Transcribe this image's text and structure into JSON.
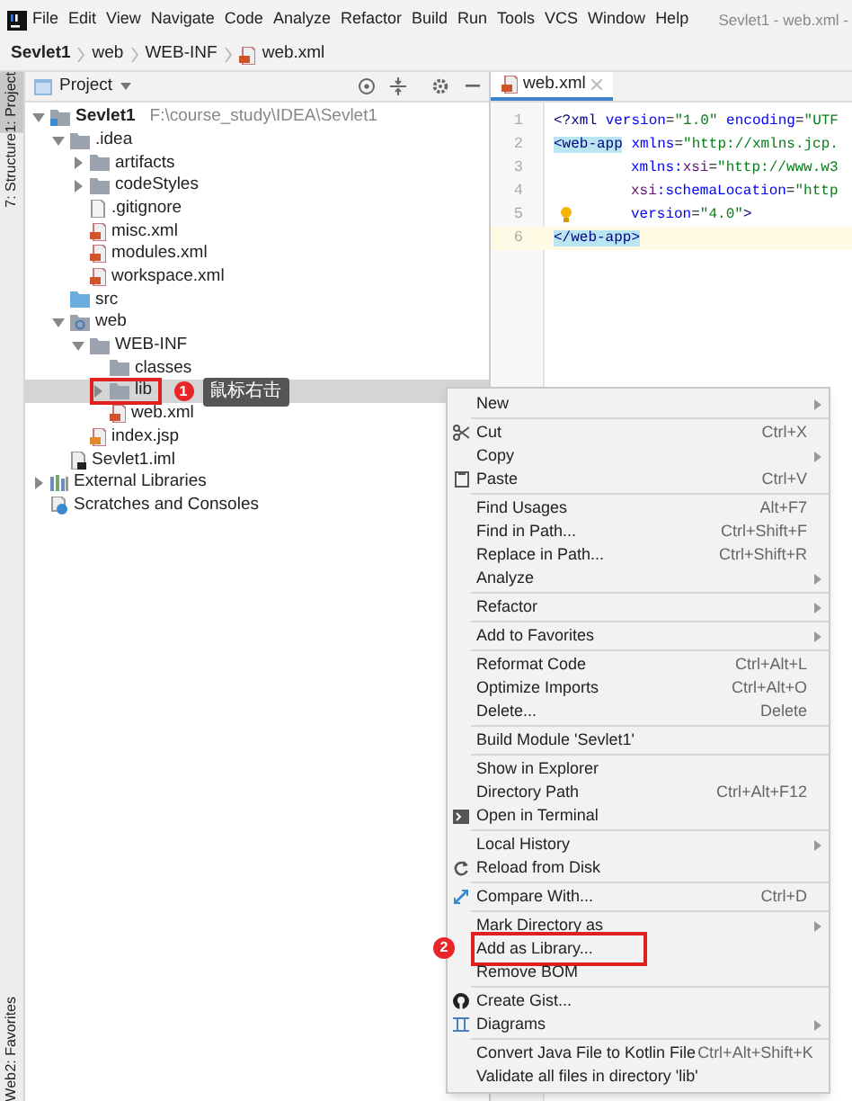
{
  "window": {
    "title": "Sevlet1 - web.xml -"
  },
  "menu_bar": [
    "File",
    "Edit",
    "View",
    "Navigate",
    "Code",
    "Analyze",
    "Refactor",
    "Build",
    "Run",
    "Tools",
    "VCS",
    "Window",
    "Help"
  ],
  "breadcrumb": [
    "Sevlet1",
    "web",
    "WEB-INF",
    "web.xml"
  ],
  "side_stripe": {
    "top": [
      {
        "label": "1: Project",
        "selected": true
      },
      {
        "label": "7: Structure",
        "selected": false
      }
    ],
    "bottom": [
      {
        "label": "2: Favorites",
        "selected": false
      },
      {
        "label": "Web",
        "selected": false
      }
    ]
  },
  "project_panel": {
    "title": "Project",
    "tree": [
      {
        "label": "Sevlet1",
        "path": "F:\\course_study\\IDEA\\Sevlet1",
        "kind": "project",
        "expanded": true,
        "selected": false,
        "children": [
          {
            "label": ".idea",
            "kind": "folder",
            "expanded": true,
            "selected": false,
            "children": [
              {
                "label": "artifacts",
                "kind": "folder",
                "expanded": false,
                "selected": false
              },
              {
                "label": "codeStyles",
                "kind": "folder",
                "expanded": false,
                "selected": false
              },
              {
                "label": ".gitignore",
                "kind": "file",
                "selected": false
              },
              {
                "label": "misc.xml",
                "kind": "xml",
                "selected": false
              },
              {
                "label": "modules.xml",
                "kind": "xml",
                "selected": false
              },
              {
                "label": "workspace.xml",
                "kind": "xml",
                "selected": false
              }
            ]
          },
          {
            "label": "src",
            "kind": "source",
            "selected": false
          },
          {
            "label": "web",
            "kind": "web",
            "expanded": true,
            "selected": false,
            "children": [
              {
                "label": "WEB-INF",
                "kind": "folder",
                "expanded": true,
                "selected": false,
                "children": [
                  {
                    "label": "classes",
                    "kind": "folder",
                    "selected": false
                  },
                  {
                    "label": "lib",
                    "kind": "folder",
                    "expanded": false,
                    "selected": true,
                    "highlighted": true,
                    "badge": "1",
                    "note": "鼠标右击"
                  },
                  {
                    "label": "web.xml",
                    "kind": "xml",
                    "selected": false
                  }
                ]
              },
              {
                "label": "index.jsp",
                "kind": "jsp",
                "selected": false
              }
            ]
          },
          {
            "label": "Sevlet1.iml",
            "kind": "module",
            "selected": false
          }
        ]
      },
      {
        "label": "External Libraries",
        "kind": "libraries",
        "expanded": false,
        "selected": false
      },
      {
        "label": "Scratches and Consoles",
        "kind": "scratches",
        "selected": false
      }
    ]
  },
  "editor": {
    "tab": {
      "label": "web.xml",
      "selected": true
    },
    "lines": [
      {
        "number": "1",
        "current": false,
        "tokens": [
          {
            "text": "<?xml ",
            "kind": "tag"
          },
          {
            "text": "version",
            "kind": "attr"
          },
          {
            "text": "=",
            "kind": "plain"
          },
          {
            "text": "\"1.0\" ",
            "kind": "value"
          },
          {
            "text": "encoding",
            "kind": "attr"
          },
          {
            "text": "=",
            "kind": "plain"
          },
          {
            "text": "\"UTF",
            "kind": "value"
          }
        ]
      },
      {
        "number": "2",
        "current": false,
        "tokens": [
          {
            "text": "<web-app",
            "kind": "match"
          },
          {
            "text": " xmlns",
            "kind": "attr"
          },
          {
            "text": "=",
            "kind": "plain"
          },
          {
            "text": "\"http://xmlns.jcp.",
            "kind": "value"
          }
        ]
      },
      {
        "number": "3",
        "current": false,
        "indent": true,
        "tokens": [
          {
            "text": "xmlns:",
            "kind": "attr"
          },
          {
            "text": "xsi",
            "kind": "ns"
          },
          {
            "text": "=",
            "kind": "plain"
          },
          {
            "text": "\"http://www.w3",
            "kind": "value"
          }
        ]
      },
      {
        "number": "4",
        "current": false,
        "indent": true,
        "tokens": [
          {
            "text": "xsi",
            "kind": "ns"
          },
          {
            "text": ":schemaLocation",
            "kind": "attr"
          },
          {
            "text": "=",
            "kind": "plain"
          },
          {
            "text": "\"http",
            "kind": "value"
          }
        ]
      },
      {
        "number": "5",
        "current": false,
        "indent": true,
        "bulb": true,
        "tokens": [
          {
            "text": "version",
            "kind": "attr"
          },
          {
            "text": "=",
            "kind": "plain"
          },
          {
            "text": "\"4.0\"",
            "kind": "value"
          },
          {
            "text": ">",
            "kind": "tag"
          }
        ]
      },
      {
        "number": "6",
        "current": true,
        "tokens": [
          {
            "text": "</web-app>",
            "kind": "match"
          }
        ]
      }
    ]
  },
  "context_menu": [
    {
      "kind": "item",
      "label": "New",
      "submenu": true
    },
    {
      "kind": "separator"
    },
    {
      "kind": "item",
      "label": "Cut",
      "shortcut": "Ctrl+X",
      "submenu": false
    },
    {
      "kind": "item",
      "label": "Copy",
      "submenu": true
    },
    {
      "kind": "item",
      "label": "Paste",
      "shortcut": "Ctrl+V",
      "submenu": false
    },
    {
      "kind": "separator"
    },
    {
      "kind": "item",
      "label": "Find Usages",
      "shortcut": "Alt+F7",
      "submenu": false
    },
    {
      "kind": "item",
      "label": "Find in Path...",
      "shortcut": "Ctrl+Shift+F",
      "submenu": false
    },
    {
      "kind": "item",
      "label": "Replace in Path...",
      "shortcut": "Ctrl+Shift+R",
      "submenu": false
    },
    {
      "kind": "item",
      "label": "Analyze",
      "submenu": true
    },
    {
      "kind": "separator"
    },
    {
      "kind": "item",
      "label": "Refactor",
      "submenu": true
    },
    {
      "kind": "separator"
    },
    {
      "kind": "item",
      "label": "Add to Favorites",
      "submenu": true
    },
    {
      "kind": "separator"
    },
    {
      "kind": "item",
      "label": "Reformat Code",
      "shortcut": "Ctrl+Alt+L",
      "submenu": false
    },
    {
      "kind": "item",
      "label": "Optimize Imports",
      "shortcut": "Ctrl+Alt+O",
      "submenu": false
    },
    {
      "kind": "item",
      "label": "Delete...",
      "shortcut": "Delete",
      "submenu": false
    },
    {
      "kind": "separator"
    },
    {
      "kind": "item",
      "label": "Build Module 'Sevlet1'",
      "submenu": false
    },
    {
      "kind": "separator"
    },
    {
      "kind": "item",
      "label": "Show in Explorer",
      "submenu": false
    },
    {
      "kind": "item",
      "label": "Directory Path",
      "shortcut": "Ctrl+Alt+F12",
      "submenu": false
    },
    {
      "kind": "item",
      "label": "Open in Terminal",
      "submenu": false
    },
    {
      "kind": "separator"
    },
    {
      "kind": "item",
      "label": "Local History",
      "submenu": true
    },
    {
      "kind": "item",
      "label": "Reload from Disk",
      "submenu": false
    },
    {
      "kind": "separator"
    },
    {
      "kind": "item",
      "label": "Compare With...",
      "shortcut": "Ctrl+D",
      "submenu": false
    },
    {
      "kind": "separator"
    },
    {
      "kind": "item",
      "label": "Mark Directory as",
      "submenu": true
    },
    {
      "kind": "item",
      "label": "Add as Library...",
      "submenu": false,
      "highlighted": true,
      "badge": "2"
    },
    {
      "kind": "item",
      "label": "Remove BOM",
      "submenu": false
    },
    {
      "kind": "separator"
    },
    {
      "kind": "item",
      "label": "Create Gist...",
      "submenu": false
    },
    {
      "kind": "item",
      "label": "Diagrams",
      "submenu": true
    },
    {
      "kind": "separator"
    },
    {
      "kind": "item",
      "label": "Convert Java File to Kotlin File",
      "shortcut": "Ctrl+Alt+Shift+K",
      "submenu": false
    },
    {
      "kind": "item",
      "label": "Validate all files in directory 'lib'",
      "submenu": false
    }
  ]
}
